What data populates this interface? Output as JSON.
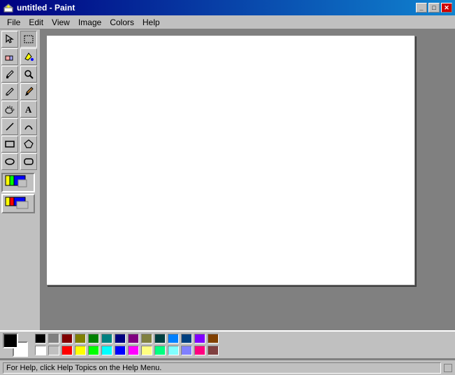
{
  "titleBar": {
    "title": "untitled - Paint",
    "iconAlt": "paint-icon",
    "buttons": {
      "minimize": "_",
      "maximize": "□",
      "close": "✕"
    }
  },
  "menuBar": {
    "items": [
      "File",
      "Edit",
      "View",
      "Image",
      "Colors",
      "Help"
    ]
  },
  "toolbar": {
    "tools": [
      {
        "name": "select-free",
        "icon": "✦",
        "title": "Free Select"
      },
      {
        "name": "select-rect",
        "icon": "⬚",
        "title": "Select"
      },
      {
        "name": "eraser",
        "icon": "◻",
        "title": "Eraser"
      },
      {
        "name": "fill",
        "icon": "⬥",
        "title": "Fill"
      },
      {
        "name": "eyedropper",
        "icon": "✒",
        "title": "Pick Color"
      },
      {
        "name": "magnifier",
        "icon": "⊕",
        "title": "Magnifier"
      },
      {
        "name": "pencil",
        "icon": "✏",
        "title": "Pencil"
      },
      {
        "name": "brush",
        "icon": "🖌",
        "title": "Brush"
      },
      {
        "name": "airbrush",
        "icon": "⊛",
        "title": "Airbrush"
      },
      {
        "name": "text",
        "icon": "A",
        "title": "Text"
      },
      {
        "name": "line",
        "icon": "╱",
        "title": "Line"
      },
      {
        "name": "curve",
        "icon": "⌒",
        "title": "Curve"
      },
      {
        "name": "rect-outline",
        "icon": "▭",
        "title": "Rectangle"
      },
      {
        "name": "polygon",
        "icon": "⬠",
        "title": "Polygon"
      },
      {
        "name": "ellipse",
        "icon": "⬭",
        "title": "Ellipse"
      },
      {
        "name": "rounded-rect",
        "icon": "▢",
        "title": "Rounded Rectangle"
      }
    ],
    "extraTools": [
      {
        "name": "tool-extra-1",
        "active": true
      },
      {
        "name": "tool-extra-2",
        "active": false
      }
    ]
  },
  "palette": {
    "foreground": "#000000",
    "background": "#ffffff",
    "colors": [
      "#000000",
      "#808080",
      "#800000",
      "#808000",
      "#008000",
      "#008080",
      "#000080",
      "#800080",
      "#808040",
      "#004040",
      "#0080ff",
      "#004080",
      "#8000ff",
      "#804000",
      "#ffffff",
      "#c0c0c0",
      "#ff0000",
      "#ffff00",
      "#00ff00",
      "#00ffff",
      "#0000ff",
      "#ff00ff",
      "#ffff80",
      "#00ff80",
      "#80ffff",
      "#8080ff",
      "#ff0080",
      "#804040"
    ]
  },
  "statusBar": {
    "text": "For Help, click Help Topics on the Help Menu."
  }
}
